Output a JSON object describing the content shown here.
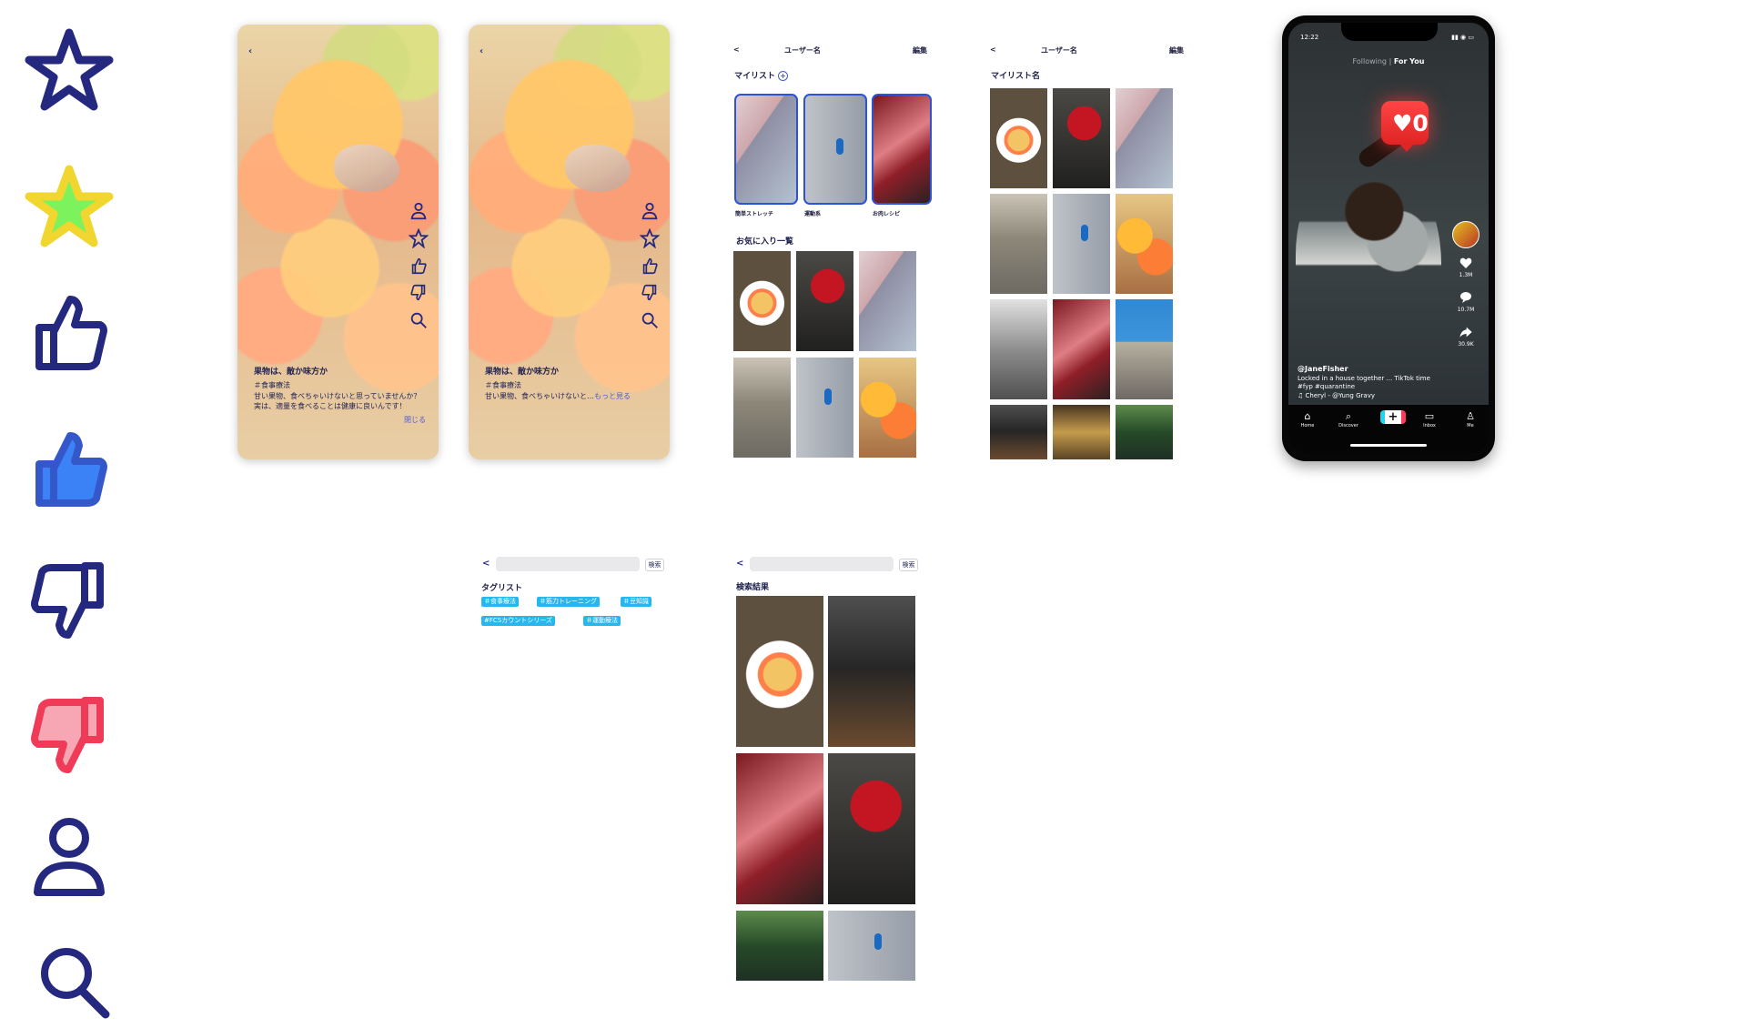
{
  "icons": {
    "star_outline": "star-outline-icon",
    "star_filled": "star-filled-icon",
    "thumb_up_outline": "thumb-up-outline-icon",
    "thumb_up_filled": "thumb-up-filled-icon",
    "thumb_down_outline": "thumb-down-outline-icon",
    "thumb_down_filled": "thumb-down-filled-icon",
    "user": "user-icon",
    "search": "search-icon"
  },
  "colors": {
    "navy": "#25287f",
    "blue": "#3b82f6",
    "yellow": "#f0d62f",
    "pink": "#f7a6b4",
    "red": "#ef3b58",
    "chip": "#27b7ef"
  },
  "post_screens": [
    {
      "title": "果物は、敵か味方か",
      "tag": "＃食事療法",
      "body": "甘い果物、食べちゃいけないと思っていませんか？実は、適量を食べることは健康に良いんです！",
      "close": "閉じる"
    },
    {
      "title": "果物は、敵か味方か",
      "tag": "＃食事療法",
      "body_prefix": "甘い果物、食べちゃいけないと…",
      "more": "もっと見る"
    }
  ],
  "profile_screen": {
    "back": "<",
    "username": "ユーザー名",
    "edit": "編集",
    "mylist_label": "マイリスト",
    "mylists": [
      "簡単ストレッチ",
      "運動系",
      "お肉レシピ"
    ],
    "favorites_label": "お気に入り一覧"
  },
  "mylist_detail": {
    "back": "<",
    "username": "ユーザー名",
    "edit": "編集",
    "mylist_name": "マイリスト名"
  },
  "tag_search": {
    "back": "<",
    "search_button": "検索",
    "taglist_label": "タグリスト",
    "tags": [
      "＃食事療法",
      "＃筋力トレーニング",
      "＃豆知識",
      "#FCSカウントシリーズ",
      "＃運動療法"
    ]
  },
  "search_results": {
    "back": "<",
    "search_button": "検索",
    "label": "検索結果"
  },
  "tiktok": {
    "time": "12:22",
    "following": "Following",
    "for_you": "For You",
    "notification_count": "0",
    "likes": "1.3M",
    "comments": "10.7M",
    "shares": "30.9K",
    "username": "@JaneFisher",
    "caption": "Locked in a house together ... TikTok time #fyp #quarantine",
    "music": "Cheryl - @Yung Gravy",
    "tabs": [
      "Home",
      "Discover",
      "Inbox",
      "Me"
    ]
  }
}
